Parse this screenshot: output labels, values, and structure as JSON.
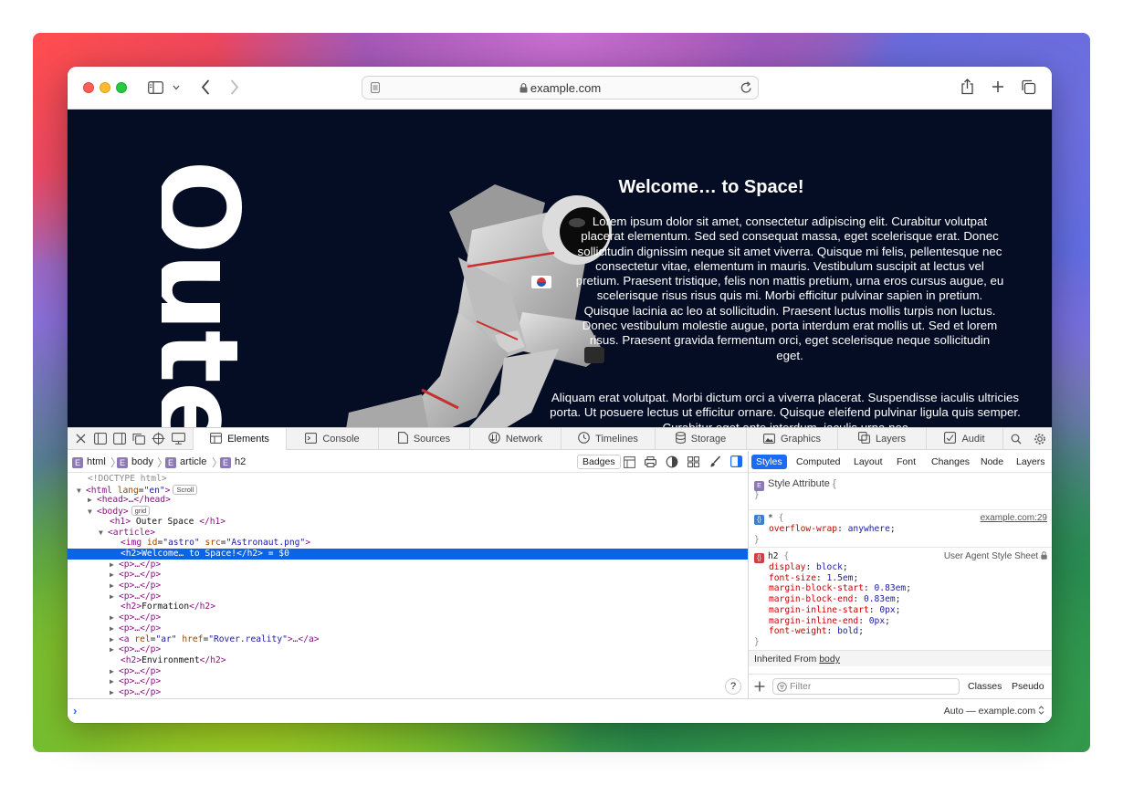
{
  "browser": {
    "url": "example.com",
    "colors": {
      "page_bg": "#050d24",
      "selection": "#0a64e8",
      "accent": "#1a6cf2"
    }
  },
  "page": {
    "big_title": "Outer",
    "h2": "Welcome… to Space!",
    "p1": "Lorem ipsum dolor sit amet, consectetur adipiscing elit. Curabitur volutpat placerat elementum. Sed sed consequat massa, eget scelerisque erat. Donec sollicitudin dignissim neque sit amet viverra. Quisque mi felis, pellentesque nec consectetur vitae, elementum in mauris. Vestibulum suscipit at lectus vel pretium. Praesent tristique, felis non mattis pretium, urna eros cursus augue, eu scelerisque risus risus quis mi. Morbi efficitur pulvinar sapien in pretium. Quisque lacinia ac leo at sollicitudin. Praesent luctus mollis turpis non luctus. Donec vestibulum molestie augue, porta interdum erat mollis ut. Sed et lorem risus. Praesent gravida fermentum orci, eget scelerisque neque sollicitudin eget.",
    "p2": "Aliquam erat volutpat. Morbi dictum orci a viverra placerat. Suspendisse iaculis ultricies porta. Ut posuere lectus ut efficitur ornare. Quisque eleifend pulvinar ligula quis semper. Curabitur eget ante interdum, iaculis urna nec"
  },
  "devtools": {
    "tabs": [
      "Elements",
      "Console",
      "Sources",
      "Network",
      "Timelines",
      "Storage",
      "Graphics",
      "Layers",
      "Audit"
    ],
    "active_tab": "Elements",
    "breadcrumbs": [
      "html",
      "body",
      "article",
      "h2"
    ],
    "badges_label": "Badges",
    "dom": {
      "doctype": "<!DOCTYPE html>",
      "html_open": "<html",
      "html_attr": "lang",
      "html_val": "\"en\"",
      "html_close": ">",
      "scroll_badge": "Scroll",
      "head": "<head>…</head>",
      "body_open": "<body>",
      "grid_badge": "grid",
      "h1_open": "<h1>",
      "h1_text": " Outer Space ",
      "h1_close": "</h1>",
      "article_open": "<article>",
      "img_open": "<img",
      "img_attr1": "id",
      "img_val1": "\"astro\"",
      "img_attr2": "src",
      "img_val2": "\"Astronaut.png\"",
      "img_close": ">",
      "selected_open": "<h2>",
      "selected_text": "Welcome… to Space!",
      "selected_close": "</h2>",
      "selected_suffix": " = $0",
      "p_collapsed": "<p>…</p>",
      "h2_open": "<h2>",
      "h2_close": "</h2>",
      "formation": "Formation",
      "environment": "Environment",
      "a_open": "<a",
      "a_attr1": "rel",
      "a_val1": "\"ar\"",
      "a_attr2": "href",
      "a_val2": "\"Rover.reality\"",
      "a_close": ">…</a>"
    },
    "help_label": "?",
    "console_prompt": "›",
    "context_selector": "Auto — example.com",
    "sidebar": {
      "tabs": [
        "Styles",
        "Computed",
        "Layout",
        "Font",
        "Changes",
        "Node",
        "Layers"
      ],
      "active_tab": "Styles",
      "style_attr_label": "Style Attribute",
      "open_brace": "{",
      "close_brace": "}",
      "rule1_selector": "*",
      "rule1_source": "example.com:29",
      "rule1_prop": "overflow-wrap",
      "rule1_value": "anywhere",
      "rule2_selector": "h2",
      "rule2_source": "User Agent Style Sheet",
      "rule2_decls": [
        {
          "prop": "display",
          "value": "block"
        },
        {
          "prop": "font-size",
          "value": "1.5em"
        },
        {
          "prop": "margin-block-start",
          "value": "0.83em"
        },
        {
          "prop": "margin-block-end",
          "value": "0.83em"
        },
        {
          "prop": "margin-inline-start",
          "value": "0px"
        },
        {
          "prop": "margin-inline-end",
          "value": "0px"
        },
        {
          "prop": "font-weight",
          "value": "bold"
        }
      ],
      "inherited_prefix": "Inherited From ",
      "inherited_from": "body",
      "filter_placeholder": "Filter",
      "classes_label": "Classes",
      "pseudo_label": "Pseudo"
    }
  }
}
